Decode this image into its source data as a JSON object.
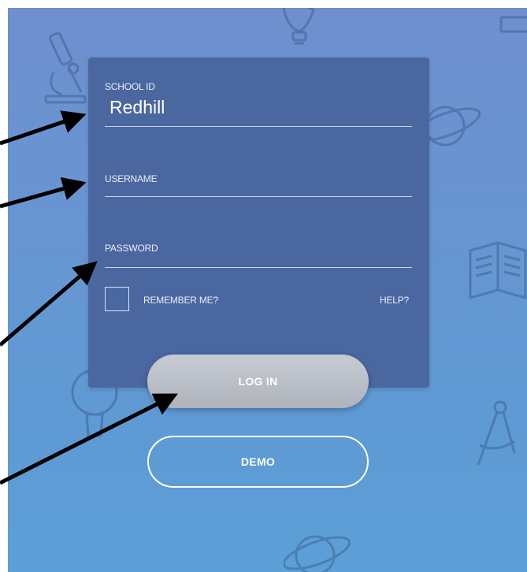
{
  "login_form": {
    "school_id_label": "SCHOOL ID",
    "school_id_value": "Redhill",
    "username_label": "USERNAME",
    "password_label": "PASSWORD",
    "remember_label": "REMEMBER ME?",
    "remember_checked": false,
    "help_label": "HELP?",
    "login_button": "LOG IN",
    "demo_button": "DEMO"
  },
  "background_icons": [
    "microscope-icon",
    "lightbulb-icon",
    "planet-icon",
    "book-icon",
    "compass-icon"
  ],
  "annotation_arrows": [
    "school-id-arrow",
    "username-arrow",
    "password-arrow",
    "login-arrow"
  ],
  "colors": {
    "background_top": "#6f8fcf",
    "background_bottom": "#5c9fd7",
    "panel": "#4b67a0",
    "login_button": "#b8bcc4",
    "arrow": "#000000"
  }
}
